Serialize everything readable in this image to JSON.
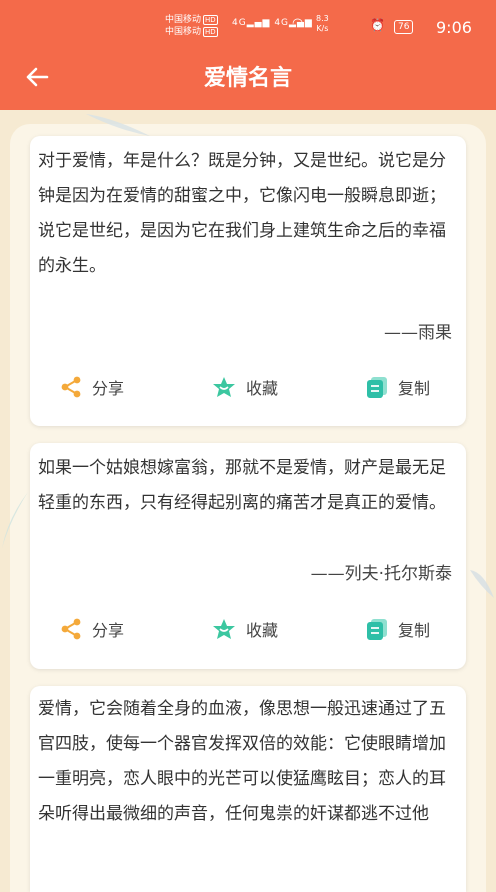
{
  "status_bar": {
    "carrier_1": "中国移动",
    "carrier_2": "中国移动",
    "hd_badge": "HD",
    "network": "4G",
    "speed_value": "8.3",
    "speed_unit": "K/s",
    "battery": "76",
    "time": "9:06"
  },
  "header": {
    "title": "爱情名言",
    "back_icon": "arrow-left-icon"
  },
  "colors": {
    "header": "#f46a4a",
    "background": "#f6ead2",
    "share_icon": "#f4a93a",
    "favorite_icon": "#3cc7a0",
    "copy_icon": "#2ebfa7"
  },
  "quotes": [
    {
      "text": "对于爱情，年是什么？既是分钟，又是世纪。说它是分钟是因为在爱情的甜蜜之中，它像闪电一般瞬息即逝；说它是世纪，是因为它在我们身上建筑生命之后的幸福的永生。",
      "author": "——雨果",
      "share_label": "分享",
      "favorite_label": "收藏",
      "copy_label": "复制"
    },
    {
      "text": "如果一个姑娘想嫁富翁，那就不是爱情，财产是最无足轻重的东西，只有经得起别离的痛苦才是真正的爱情。",
      "author": "——列夫·托尔斯泰",
      "share_label": "分享",
      "favorite_label": "收藏",
      "copy_label": "复制"
    },
    {
      "text": "爱情，它会随着全身的血液，像思想一般迅速通过了五官四肢，使每一个器官发挥双倍的效能：它使眼睛增加一重明亮，恋人眼中的光芒可以使猛鹰眩目；恋人的耳朵听得出最微细的声音，任何鬼祟的奸谋都逃不过他"
    }
  ]
}
